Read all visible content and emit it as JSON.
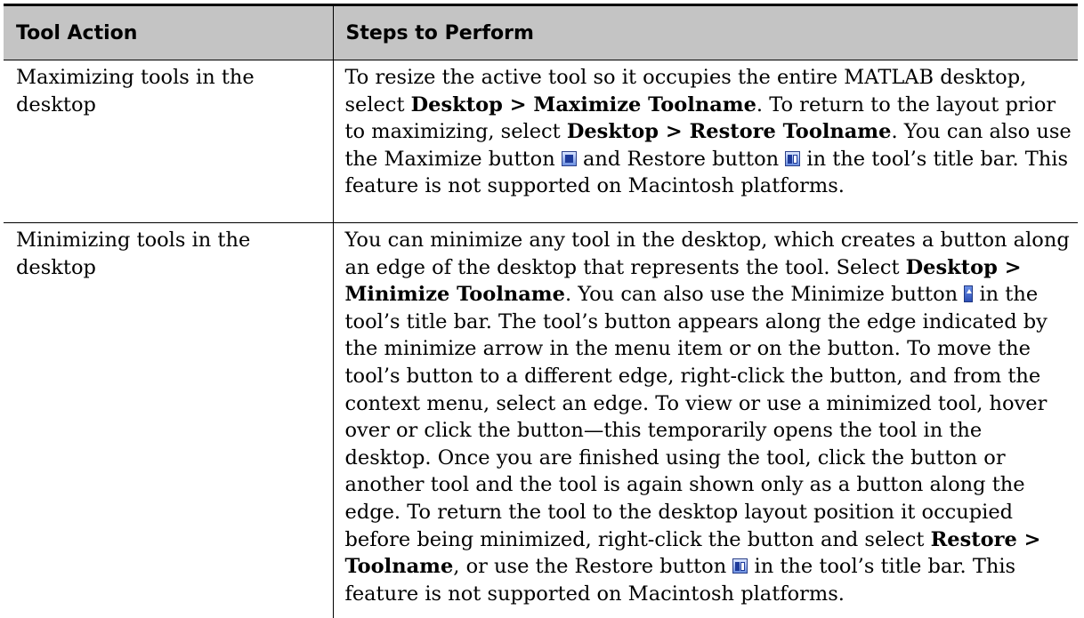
{
  "table": {
    "headers": [
      "Tool Action",
      "Steps to Perform"
    ],
    "rows": [
      {
        "action": "Maximizing tools in the desktop",
        "steps": {
          "t1": "To resize the active tool so it occupies the entire MATLAB desktop, select ",
          "b1": "Desktop > Maximize Toolname",
          "t2": ". To return to the layout prior to maximizing, select ",
          "b2": "Desktop > Restore Toolname",
          "t3": ". You can also use the Maximize button ",
          "t4": " and Restore button ",
          "t5": " in the tool’s title bar. This feature is not supported on Macintosh platforms."
        }
      },
      {
        "action": "Minimizing tools in the desktop",
        "steps": {
          "t1": "You can minimize any tool in the desktop, which creates a button along an edge of the desktop that represents the tool. Select ",
          "b1": "Desktop > Minimize Toolname",
          "t2": ". You can also use the Minimize button ",
          "t3": " in the tool’s title bar. The tool’s button appears along the edge indicated by the minimize arrow in the menu item or on the button. To move the tool’s button to a different edge, right-click the button, and from the context menu, select an edge. To view or use a minimized tool, hover over or click the button—this temporarily opens the tool in the desktop. Once you are finished using the tool, click the button or another tool and the tool is again shown only as a button along the edge. To return the tool to the desktop layout position it occupied before being minimized, right-click the button and select ",
          "b2": "Restore > Toolname",
          "t4": ", or use the Restore button ",
          "t5": " in the tool’s title bar. This feature is not supported on Macintosh platforms."
        }
      }
    ]
  },
  "icons": {
    "maximize": "maximize-button-icon",
    "restore": "restore-button-icon",
    "minimize": "minimize-button-icon"
  },
  "colors": {
    "header_bg": "#c4c4c4",
    "icon_blue": "#2d4fb5"
  }
}
